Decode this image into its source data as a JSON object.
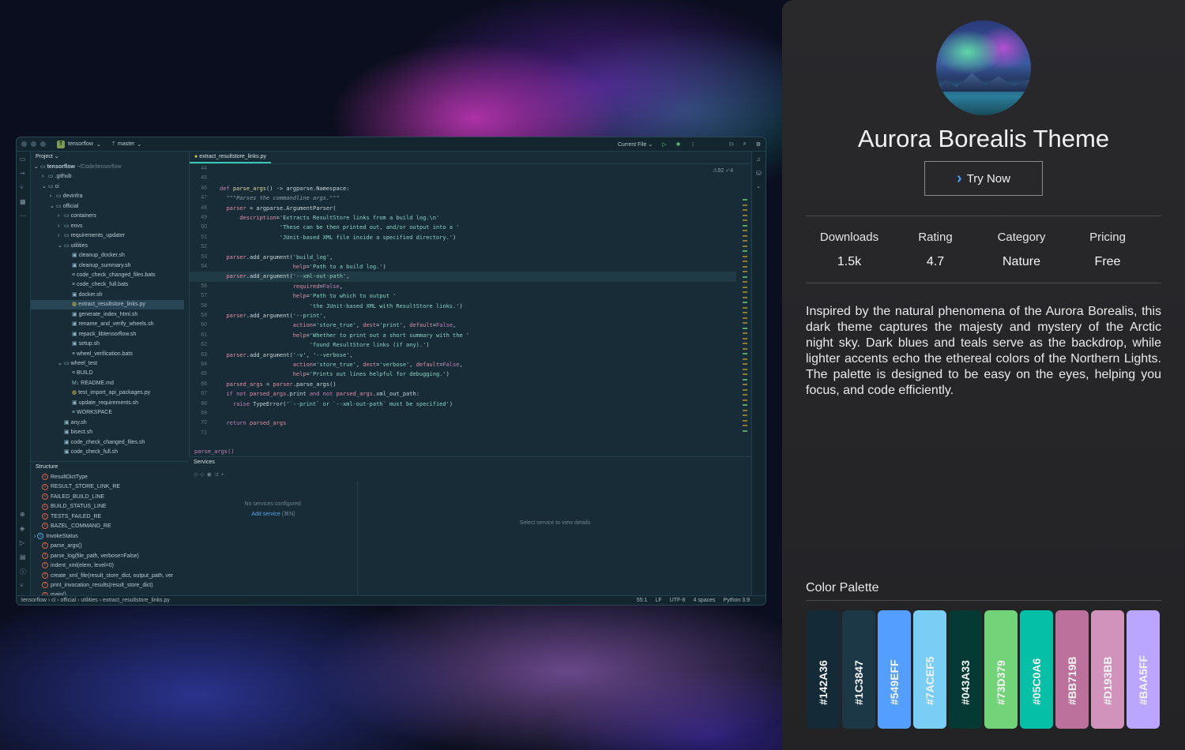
{
  "ide": {
    "project_name": "tensorflow",
    "project_initial": "T",
    "branch": "master",
    "run_config": "Current File",
    "project_panel_title": "Project",
    "structure_title": "Structure",
    "services_title": "Services",
    "editor_tab": "extract_resultstore_links.py",
    "inspection": "⚠92 ✓4",
    "breadcrumb_fn": "parse_args()",
    "tree": [
      {
        "label": "tensorflow",
        "extra": "~/Code/tensorflow",
        "depth": 0,
        "arrow": "⌄",
        "icon": "folder"
      },
      {
        "label": ".github",
        "depth": 1,
        "arrow": "›",
        "icon": "folder"
      },
      {
        "label": "ci",
        "depth": 1,
        "arrow": "⌄",
        "icon": "folder"
      },
      {
        "label": "devinfra",
        "depth": 2,
        "arrow": "›",
        "icon": "folder"
      },
      {
        "label": "official",
        "depth": 2,
        "arrow": "⌄",
        "icon": "folder"
      },
      {
        "label": "containers",
        "depth": 3,
        "arrow": "›",
        "icon": "folder"
      },
      {
        "label": "envs",
        "depth": 3,
        "arrow": "›",
        "icon": "folder"
      },
      {
        "label": "requirements_updater",
        "depth": 3,
        "arrow": "›",
        "icon": "folder"
      },
      {
        "label": "utilities",
        "depth": 3,
        "arrow": "⌄",
        "icon": "folder"
      },
      {
        "label": "cleanup_docker.sh",
        "depth": 4,
        "arrow": "",
        "icon": "sh"
      },
      {
        "label": "cleanup_summary.sh",
        "depth": 4,
        "arrow": "",
        "icon": "sh"
      },
      {
        "label": "code_check_changed_files.bats",
        "depth": 4,
        "arrow": "",
        "icon": "txt"
      },
      {
        "label": "code_check_full.bats",
        "depth": 4,
        "arrow": "",
        "icon": "txt"
      },
      {
        "label": "docker.sh",
        "depth": 4,
        "arrow": "",
        "icon": "sh"
      },
      {
        "label": "extract_resultstore_links.py",
        "depth": 4,
        "arrow": "",
        "icon": "py",
        "selected": true
      },
      {
        "label": "generate_index_html.sh",
        "depth": 4,
        "arrow": "",
        "icon": "sh"
      },
      {
        "label": "rename_and_verify_wheels.sh",
        "depth": 4,
        "arrow": "",
        "icon": "sh"
      },
      {
        "label": "repack_libtensorflow.sh",
        "depth": 4,
        "arrow": "",
        "icon": "sh"
      },
      {
        "label": "setup.sh",
        "depth": 4,
        "arrow": "",
        "icon": "sh"
      },
      {
        "label": "wheel_verification.bats",
        "depth": 4,
        "arrow": "",
        "icon": "txt"
      },
      {
        "label": "wheel_test",
        "depth": 3,
        "arrow": "⌄",
        "icon": "folder"
      },
      {
        "label": "BUILD",
        "depth": 4,
        "arrow": "",
        "icon": "txt"
      },
      {
        "label": "README.md",
        "depth": 4,
        "arrow": "",
        "icon": "md"
      },
      {
        "label": "test_import_api_packages.py",
        "depth": 4,
        "arrow": "",
        "icon": "py"
      },
      {
        "label": "update_requirements.sh",
        "depth": 4,
        "arrow": "",
        "icon": "sh"
      },
      {
        "label": "WORKSPACE",
        "depth": 4,
        "arrow": "",
        "icon": "txt"
      },
      {
        "label": "any.sh",
        "depth": 3,
        "arrow": "",
        "icon": "sh"
      },
      {
        "label": "bisect.sh",
        "depth": 3,
        "arrow": "",
        "icon": "sh"
      },
      {
        "label": "code_check_changed_files.sh",
        "depth": 3,
        "arrow": "",
        "icon": "sh"
      },
      {
        "label": "code_check_full.sh",
        "depth": 3,
        "arrow": "",
        "icon": "sh"
      }
    ],
    "structure": [
      {
        "label": "ResultDictType",
        "icon": "v"
      },
      {
        "label": "RESULT_STORE_LINK_RE",
        "icon": "v"
      },
      {
        "label": "FAILED_BUILD_LINE",
        "icon": "v"
      },
      {
        "label": "BUILD_STATUS_LINE",
        "icon": "v"
      },
      {
        "label": "TESTS_FAILED_RE",
        "icon": "v"
      },
      {
        "label": "BAZEL_COMMAND_RE",
        "icon": "v"
      },
      {
        "label": "InvokeStatus",
        "icon": "c",
        "arrow": "›"
      },
      {
        "label": "parse_args()",
        "icon": "f"
      },
      {
        "label": "parse_log(file_path, verbose=False)",
        "icon": "f"
      },
      {
        "label": "indent_xml(elem, level=0)",
        "icon": "f"
      },
      {
        "label": "create_xml_file(result_store_dict, output_path, ver",
        "icon": "f"
      },
      {
        "label": "print_invocation_results(result_store_dict)",
        "icon": "f"
      },
      {
        "label": "main()",
        "icon": "f"
      }
    ],
    "line_numbers": [
      "44",
      "45",
      "46",
      "47",
      "48",
      "49",
      "50",
      "51",
      "52",
      "53",
      "54",
      "55",
      "56",
      "57",
      "58",
      "59",
      "60",
      "61",
      "62",
      "63",
      "64",
      "65",
      "66",
      "67",
      "68",
      "69",
      "70",
      "71"
    ],
    "code": [
      "",
      "",
      "<span class='kw'>def</span> <span class='fn'>parse_args</span>() -> argparse.Namespace:",
      "  <span class='cm'>\"\"\"Parses the commandline args.\"\"\"</span>",
      "  <span class='par'>parser</span> = argparse.ArgumentParser(",
      "      <span class='par'>description</span>=<span class='str'>'Extracts ResultStore links from a build log.\\n'</span>",
      "                  <span class='str'>'These can be then printed out, and/or output into a '</span>",
      "                  <span class='str'>'JUnit-based XML file inside a specified directory.'</span>)",
      "",
      "  <span class='par'>parser</span>.add_argument(<span class='str'>'build_log'</span>,",
      "                      <span class='par'>help</span>=<span class='str'>'Path to a build log.'</span>)",
      "  <span class='par'>parser</span>.add_argument(<span class='str'>'--xml-out-path'</span>,",
      "                      <span class='par'>required</span>=<span class='kw'>False</span>,",
      "                      <span class='par'>help</span>=<span class='str'>'Path to which to output '</span>",
      "                           <span class='str'>'the JUnit-based XML with ResultStore links.'</span>)",
      "  <span class='par'>parser</span>.add_argument(<span class='str'>'--print'</span>,",
      "                      <span class='par'>action</span>=<span class='str'>'store_true'</span>, <span class='par'>dest</span>=<span class='str'>'print'</span>, <span class='par'>default</span>=<span class='kw'>False</span>,",
      "                      <span class='par'>help</span>=<span class='str'>'Whether to print out a short summary with the '</span>",
      "                           <span class='str'>'found ResultStore links (if any).'</span>)",
      "  <span class='par'>parser</span>.add_argument(<span class='str'>'-v'</span>, <span class='str'>'--verbose'</span>,",
      "                      <span class='par'>action</span>=<span class='str'>'store_true'</span>, <span class='par'>dest</span>=<span class='str'>'verbose'</span>, <span class='par'>default</span>=<span class='kw'>False</span>,",
      "                      <span class='par'>help</span>=<span class='str'>'Prints out lines helpful for debugging.'</span>)",
      "  <span class='par'>parsed_args</span> = <span class='par'>parser</span>.parse_args()",
      "  <span class='kw'>if not</span> <span class='par'>parsed_args</span>.print <span class='kw'>and not</span> <span class='par'>parsed_args</span>.xml_out_path:",
      "    <span class='kw'>raise</span> TypeError(<span class='str'>'`--print` or `--xml-out-path` must be specified'</span>)",
      "",
      "  <span class='kw'>return</span> <span class='par'>parsed_args</span>",
      ""
    ],
    "highlighted_line_index": 11,
    "services": {
      "empty": "No services configured.",
      "add": "Add service",
      "add_shortcut": "(⌘N)",
      "detail": "Select service to view details"
    },
    "status_path": [
      "tensorflow",
      "ci",
      "official",
      "utilities",
      "extract_resultstore_links.py"
    ],
    "status_right": [
      "55:1",
      "LF",
      "UTF-8",
      "4 spaces",
      "Python 3.9"
    ]
  },
  "theme": {
    "title": "Aurora Borealis Theme",
    "try_label": "Try Now",
    "stats": [
      {
        "label": "Downloads",
        "value": "1.5k"
      },
      {
        "label": "Rating",
        "value": "4.7"
      },
      {
        "label": "Category",
        "value": "Nature"
      },
      {
        "label": "Pricing",
        "value": "Free"
      }
    ],
    "description": "Inspired by the natural phenomena of the Aurora Borealis, this dark theme captures the majesty and mystery of the Arctic night sky. Dark blues and teals serve as the backdrop, while lighter accents echo the ethereal colors of the Northern Lights. The palette is designed to be easy on the eyes, helping you focus, and code efficiently.",
    "palette_title": "Color Palette",
    "palette": [
      "#142A36",
      "#1C3847",
      "#549EFF",
      "#7ACEF5",
      "#043A33",
      "#73D379",
      "#05C0A6",
      "#BB719B",
      "#D193BB",
      "#BAA5FF"
    ]
  }
}
